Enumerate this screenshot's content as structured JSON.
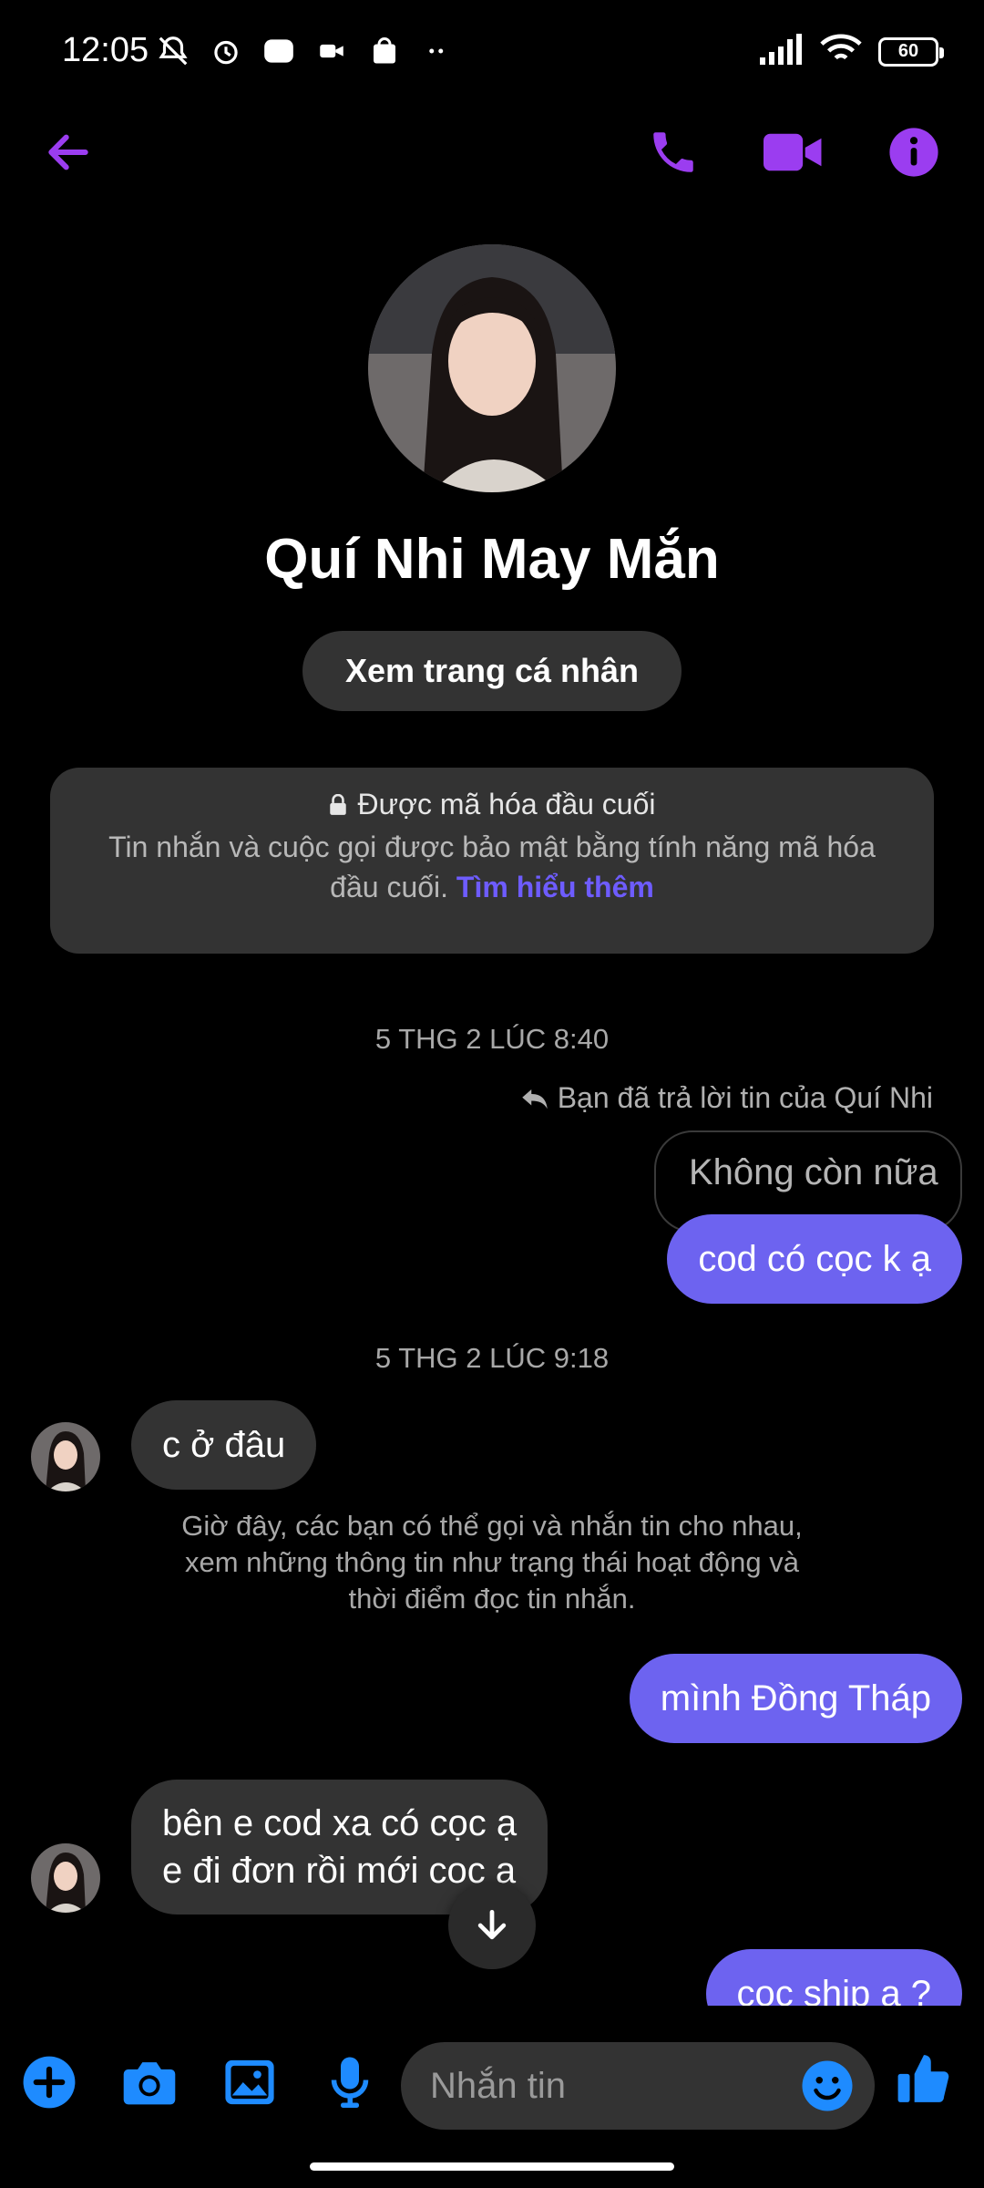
{
  "status_bar": {
    "time": "12:05",
    "battery": "60"
  },
  "contact": {
    "name": "Quí Nhi May Mắn",
    "profile_button": "Xem trang cá nhân"
  },
  "encryption": {
    "title": "Được mã hóa đầu cuối",
    "text": "Tin nhắn và cuộc gọi được bảo mật bằng tính năng mã hóa đầu cuối.",
    "link": "Tìm hiểu thêm"
  },
  "conversation": {
    "timestamp_1": "5 THG 2 LÚC 8:40",
    "reply_note": "Bạn đã trả lời tin của Quí Nhi",
    "quoted_message": "Không còn nữa",
    "msg_out_1": "cod có cọc k ạ",
    "timestamp_2": "5 THG 2 LÚC 9:18",
    "msg_in_1": "c ở đâu",
    "system_note": [
      "Giờ đây, các bạn có thể gọi và nhắn tin cho nhau,",
      "xem những thông tin như trạng thái hoạt động và",
      "thời điểm đọc tin nhắn."
    ],
    "msg_out_2": "mình Đồng Tháp",
    "msg_in_2": [
      "bên e cod xa có cọc ạ",
      "e đi đơn rồi mới coc a"
    ],
    "msg_out_3": "cọc ship ạ ?"
  },
  "composer": {
    "placeholder": "Nhắn tin"
  },
  "colors": {
    "accent": "#9b3df0",
    "bubble_out": "#6d63f0",
    "bubble_in": "#333333",
    "link": "#6e5cff",
    "tool_blue": "#1e8bff"
  },
  "icons": [
    "back-arrow-icon",
    "phone-icon",
    "video-icon",
    "info-icon",
    "lock-icon",
    "reply-icon",
    "arrow-down-icon",
    "plus-icon",
    "camera-icon",
    "gallery-icon",
    "mic-icon",
    "emoji-icon",
    "thumbs-up-icon"
  ]
}
